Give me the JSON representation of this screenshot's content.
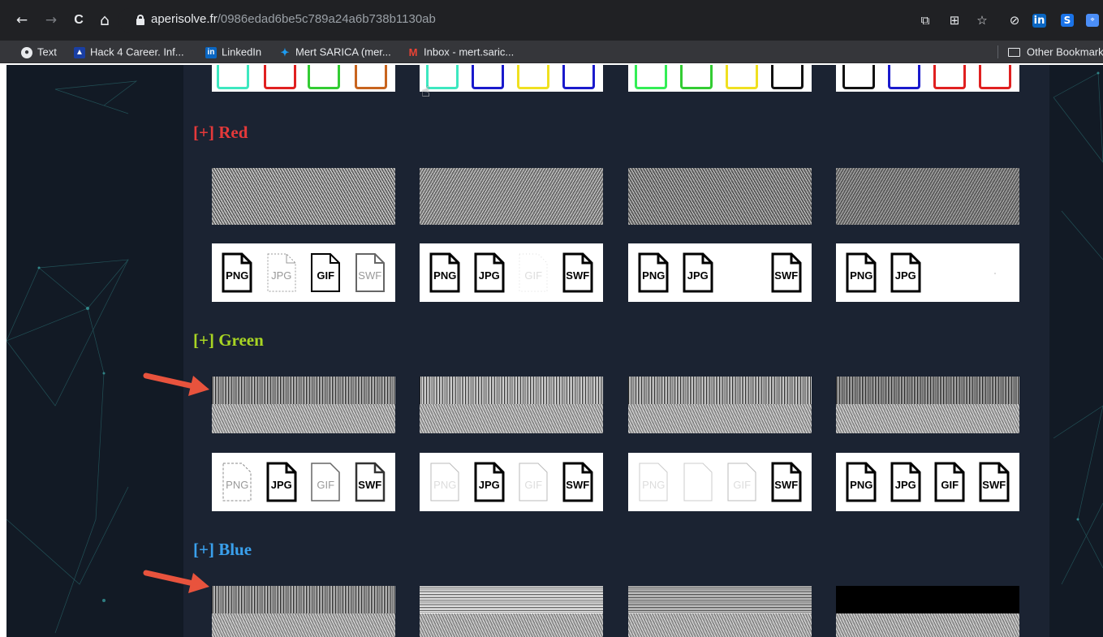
{
  "browser": {
    "url_host": "aperisolve.fr",
    "url_path": "/0986edad6be5c789a24a6b738b1130ab",
    "bookmarks": [
      {
        "label": "Text",
        "icon": "globe-icon"
      },
      {
        "label": "Hack 4 Career. Inf...",
        "icon": "hack4career-icon"
      },
      {
        "label": "LinkedIn",
        "icon": "linkedin-icon"
      },
      {
        "label": "Mert SARICA (mer...",
        "icon": "twitter-icon"
      },
      {
        "label": "Inbox - mert.saric...",
        "icon": "gmail-icon"
      }
    ],
    "other_bookmarks": "Other Bookmarks",
    "nav": {
      "back": "←",
      "forward": "→",
      "reload": "C",
      "home": "⌂"
    },
    "toolbar_icons": {
      "cast": "⧉",
      "apps": "⊞",
      "star": "☆",
      "ext1": "⊘",
      "linkedin": "in",
      "ext2": "S",
      "ext3": "⌖"
    }
  },
  "sections": {
    "red": {
      "title": "[+] Red",
      "color": "#e5393a"
    },
    "green": {
      "title": "[+] Green",
      "color": "#a8d523"
    },
    "blue": {
      "title": "[+] Blue",
      "color": "#3aa0ec"
    }
  },
  "file_labels": {
    "png": "PNG",
    "jpg": "JPG",
    "gif": "GIF",
    "swf": "SWF"
  },
  "colors": {
    "page_bg": "#121a25",
    "content_bg": "#1b2332",
    "arrow": "#e8533d",
    "chrome": "#202124",
    "bookmark_bar": "#35363a"
  }
}
